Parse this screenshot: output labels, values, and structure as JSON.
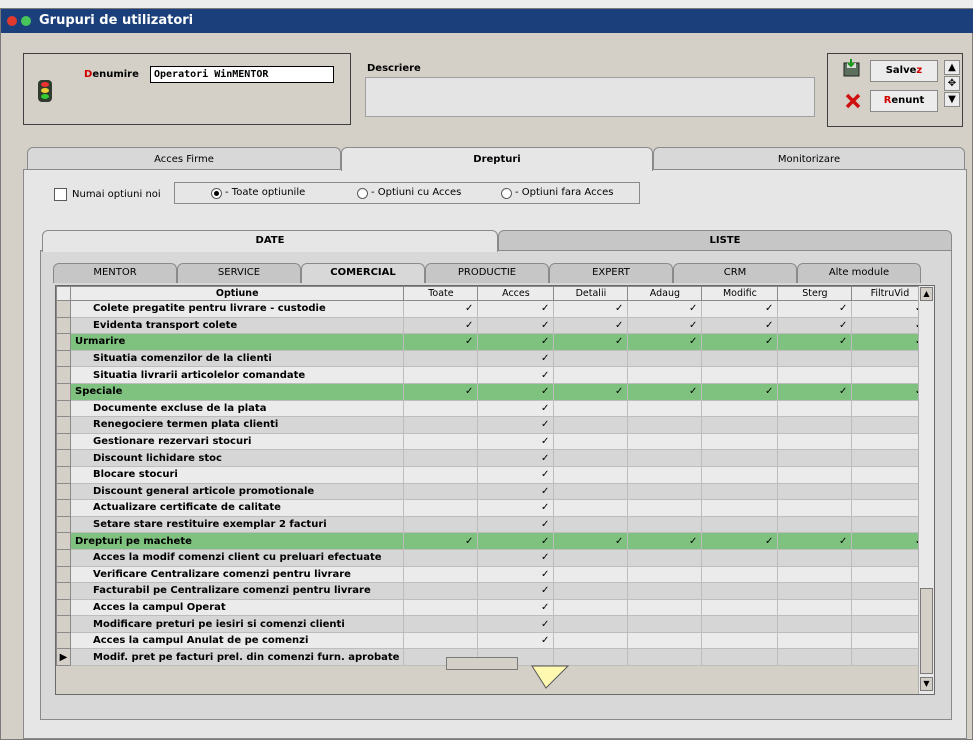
{
  "window": {
    "title": "Grupuri de utilizatori"
  },
  "header": {
    "denumire_label_first": "D",
    "denumire_label_rest": "enumire",
    "denumire_value": "Operatori WinMENTOR",
    "descriere_label": "Descriere",
    "descriere_value": ""
  },
  "buttons": {
    "save_pre": "Salve",
    "save_hot": "z",
    "cancel_hot": "R",
    "cancel_rest": "enunt"
  },
  "top_tabs": [
    "Acces Firme",
    "Drepturi",
    "Monitorizare"
  ],
  "filters": {
    "only_new": "Numai optiuni noi",
    "all": "- Toate optiunile",
    "with_access": "- Optiuni cu Acces",
    "without_access": "- Optiuni fara Acces",
    "selected": "all"
  },
  "section_tabs": [
    "DATE",
    "LISTE"
  ],
  "module_tabs": [
    "MENTOR",
    "SERVICE",
    "COMERCIAL",
    "PRODUCTIE",
    "EXPERT",
    "CRM",
    "Alte module"
  ],
  "active_module_tab": "COMERCIAL",
  "grid": {
    "columns": [
      "Optiune",
      "Toate",
      "Acces",
      "Detalii",
      "Adaug",
      "Modific",
      "Sterg",
      "FiltruVid"
    ],
    "rows": [
      {
        "name": "Colete pregatite pentru livrare - custodie",
        "group": false,
        "checks": [
          1,
          1,
          1,
          1,
          1,
          1,
          1
        ]
      },
      {
        "name": "Evidenta transport colete",
        "group": false,
        "checks": [
          1,
          1,
          1,
          1,
          1,
          1,
          1
        ]
      },
      {
        "name": "Urmarire",
        "group": true,
        "checks": [
          1,
          1,
          1,
          1,
          1,
          1,
          1
        ]
      },
      {
        "name": "Situatia comenzilor de la clienti",
        "group": false,
        "checks": [
          0,
          1,
          0,
          0,
          0,
          0,
          0
        ]
      },
      {
        "name": "Situatia livrarii articolelor comandate",
        "group": false,
        "checks": [
          0,
          1,
          0,
          0,
          0,
          0,
          0
        ]
      },
      {
        "name": "Speciale",
        "group": true,
        "checks": [
          1,
          1,
          1,
          1,
          1,
          1,
          1
        ]
      },
      {
        "name": "Documente excluse de la plata",
        "group": false,
        "checks": [
          0,
          1,
          0,
          0,
          0,
          0,
          0
        ]
      },
      {
        "name": "Renegociere termen plata clienti",
        "group": false,
        "checks": [
          0,
          1,
          0,
          0,
          0,
          0,
          0
        ]
      },
      {
        "name": "Gestionare rezervari stocuri",
        "group": false,
        "checks": [
          0,
          1,
          0,
          0,
          0,
          0,
          0
        ]
      },
      {
        "name": "Discount lichidare stoc",
        "group": false,
        "checks": [
          0,
          1,
          0,
          0,
          0,
          0,
          0
        ]
      },
      {
        "name": "Blocare stocuri",
        "group": false,
        "checks": [
          0,
          1,
          0,
          0,
          0,
          0,
          0
        ]
      },
      {
        "name": "Discount general articole promotionale",
        "group": false,
        "checks": [
          0,
          1,
          0,
          0,
          0,
          0,
          0
        ]
      },
      {
        "name": "Actualizare certificate de calitate",
        "group": false,
        "checks": [
          0,
          1,
          0,
          0,
          0,
          0,
          0
        ]
      },
      {
        "name": "Setare stare restituire exemplar 2 facturi",
        "group": false,
        "checks": [
          0,
          1,
          0,
          0,
          0,
          0,
          0
        ]
      },
      {
        "name": "Drepturi pe machete",
        "group": true,
        "checks": [
          1,
          1,
          1,
          1,
          1,
          1,
          1
        ]
      },
      {
        "name": "Acces la modif comenzi client cu preluari efectuate",
        "group": false,
        "checks": [
          0,
          1,
          0,
          0,
          0,
          0,
          0
        ]
      },
      {
        "name": "Verificare Centralizare comenzi pentru livrare",
        "group": false,
        "checks": [
          0,
          1,
          0,
          0,
          0,
          0,
          0
        ]
      },
      {
        "name": "Facturabil pe Centralizare comenzi pentru livrare",
        "group": false,
        "checks": [
          0,
          1,
          0,
          0,
          0,
          0,
          0
        ]
      },
      {
        "name": "Acces la campul Operat",
        "group": false,
        "checks": [
          0,
          1,
          0,
          0,
          0,
          0,
          0
        ]
      },
      {
        "name": "Modificare preturi pe iesiri si comenzi clienti",
        "group": false,
        "checks": [
          0,
          1,
          0,
          0,
          0,
          0,
          0
        ]
      },
      {
        "name": "Acces la campul Anulat de pe comenzi",
        "group": false,
        "checks": [
          0,
          1,
          0,
          0,
          0,
          0,
          0
        ]
      },
      {
        "name": "Modif. pret pe facturi prel. din comenzi furn. aprobate",
        "group": false,
        "checks": [
          0,
          0,
          0,
          0,
          0,
          0,
          0
        ],
        "current": true
      }
    ],
    "check_mark": "✓",
    "current_row_marker": "▶"
  },
  "colors": {
    "group_row": "#7fc27f",
    "titlebar": "#1a3f7a",
    "hotkey": "#d00000"
  }
}
